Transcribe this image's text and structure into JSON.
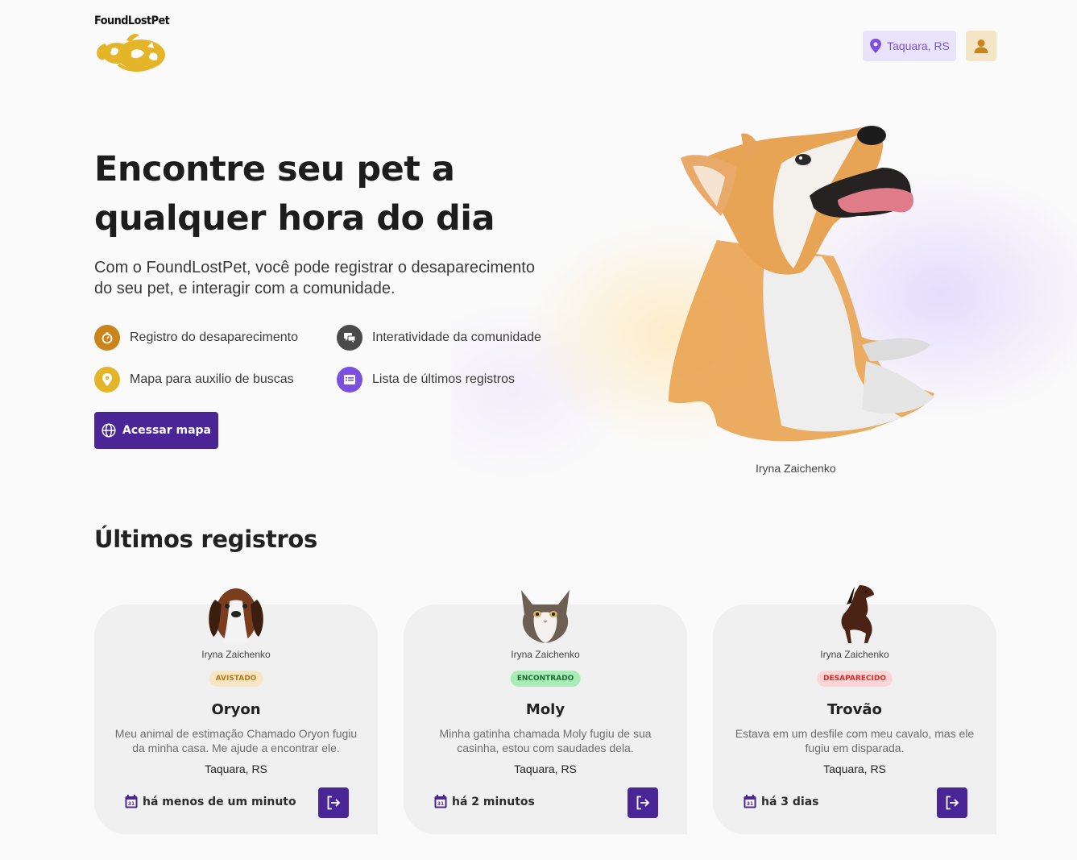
{
  "header": {
    "logo_text": "FoundLostPet",
    "location": "Taquara, RS"
  },
  "hero": {
    "title_line1": "Encontre seu pet a",
    "title_line2": "qualquer hora do dia",
    "subtitle": "Com o FoundLostPet, você pode registrar o desaparecimento do seu pet, e interagir com a comunidade.",
    "features": [
      {
        "label": "Registro do desaparecimento",
        "icon": "stopwatch-icon",
        "color": "#c9841a"
      },
      {
        "label": "Interatividade da comunidade",
        "icon": "chat-icon",
        "color": "#4a4a4a"
      },
      {
        "label": "Mapa para auxilio de buscas",
        "icon": "map-pin-icon",
        "color": "#e4b528"
      },
      {
        "label": "Lista de últimos registros",
        "icon": "list-icon",
        "color": "#7d4fe0"
      }
    ],
    "cta_label": "Acessar mapa",
    "image_credit": "Iryna Zaichenko"
  },
  "latest": {
    "title": "Últimos registros",
    "cards": [
      {
        "credit": "Iryna Zaichenko",
        "status": "AVISTADO",
        "status_bg": "#f7e6c3",
        "status_fg": "#b07a1a",
        "name": "Oryon",
        "description": "Meu animal de estimação Chamado Oryon fugiu da minha casa. Me ajude a encontrar ele.",
        "location": "Taquara, RS",
        "time": "há menos de um minuto"
      },
      {
        "credit": "Iryna Zaichenko",
        "status": "ENCONTRADO",
        "status_bg": "#a8ecb8",
        "status_fg": "#1f6b32",
        "name": "Moly",
        "description": "Minha gatinha chamada Moly fugiu de sua casinha, estou com saudades dela.",
        "location": "Taquara, RS",
        "time": "há 2 minutos"
      },
      {
        "credit": "Iryna Zaichenko",
        "status": "DESAPARECIDO",
        "status_bg": "#fcd6d6",
        "status_fg": "#d42e2e",
        "name": "Trovão",
        "description": "Estava em um desfile com meu cavalo, mas ele fugiu em disparada.",
        "location": "Taquara, RS",
        "time": "há 3 dias"
      }
    ]
  },
  "colors": {
    "primary": "#4a2596",
    "accent": "#7d4fe0",
    "gold": "#e4b528"
  }
}
